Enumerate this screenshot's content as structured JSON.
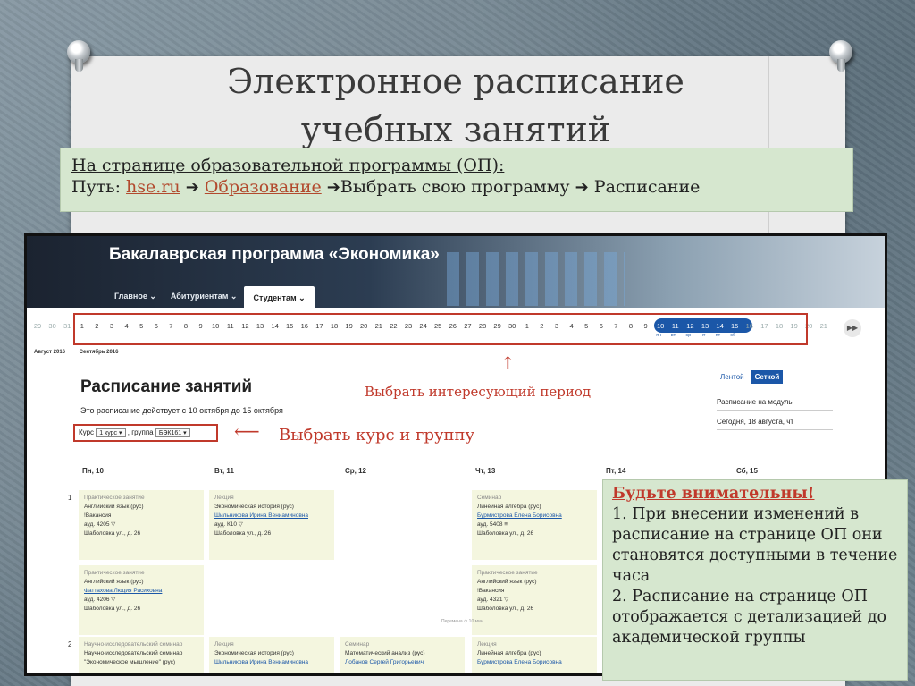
{
  "title": {
    "line1": "Электронное расписание",
    "line2": "учебных занятий"
  },
  "info": {
    "line1": "На странице образовательной программы (ОП):",
    "prefix": "Путь: ",
    "link1": "hse.ru",
    "link2": "Образование",
    "step3": "Выбрать свою программу",
    "step4": "Расписание",
    "arrow": "➔"
  },
  "site": {
    "banner_title": "Бакалаврская программа «Экономика»",
    "nav": [
      {
        "label": "Главное ⌄"
      },
      {
        "label": "Абитуриентам ⌄"
      },
      {
        "label": "Студентам ⌄"
      }
    ],
    "months": {
      "aug": "Август 2016",
      "sep": "Сентябрь 2016"
    },
    "days": [
      "29",
      "30",
      "31",
      "1",
      "2",
      "3",
      "4",
      "5",
      "6",
      "7",
      "8",
      "9",
      "10",
      "11",
      "12",
      "13",
      "14",
      "15",
      "16",
      "17",
      "18",
      "19",
      "20",
      "21",
      "22",
      "23",
      "24",
      "25",
      "26",
      "27",
      "28",
      "29",
      "30",
      "1",
      "2",
      "3",
      "4",
      "5",
      "6",
      "7",
      "8",
      "9",
      "10",
      "11",
      "12",
      "13",
      "14",
      "15",
      "16",
      "17",
      "18",
      "19",
      "20",
      "21"
    ],
    "selected_weekdays": [
      "пн",
      "вт",
      "ср",
      "чт",
      "пт",
      "сб"
    ],
    "page_title": "Расписание занятий",
    "subtitle": "Это расписание действует с 10 октября до 15 октября",
    "course_label": "Курс",
    "course_value": "1 курс ▾",
    "group_label": ", группа",
    "group_value": "БЭК161 ▾",
    "view_feed": "Лентой",
    "view_grid": "Сеткой",
    "module_link": "Расписание на модуль",
    "today": "Сегодня, 18 августа, чт",
    "columns": [
      "Пн, 10",
      "Вт, 11",
      "Ср, 12",
      "Чт, 13",
      "Пт, 14",
      "Сб, 15"
    ],
    "rows": [
      "1",
      "2"
    ],
    "cells": [
      {
        "type": "Практическое занятие",
        "subject": "Английский язык (рус)",
        "teacher": "!Вакансия",
        "room": "ауд. 4205 ▽",
        "address": "Шаболовка ул., д. 26"
      },
      {
        "type": "Лекция",
        "subject": "Экономическая история (рус)",
        "teacher": "Шильникова Ирина Вениаминовна",
        "room": "ауд. К10 ▽",
        "address": "Шаболовка ул., д. 26"
      },
      {
        "type": "Семинар",
        "subject": "Линейная алгебра (рус)",
        "teacher": "Бурмистрова Елена Борисовна",
        "room": "ауд. 5408 ≡",
        "address": "Шаболовка ул., д. 26"
      },
      {
        "type": "Практическое занятие",
        "subject": "Английский язык (рус)",
        "teacher": "Фаттахова Люция Расиховна",
        "room": "ауд. 4206 ▽",
        "address": "Шаболовка ул., д. 26"
      },
      {
        "type": "Практическое занятие",
        "subject": "Английский язык (рус)",
        "teacher": "!Вакансия",
        "room": "ауд. 4321 ▽",
        "address": "Шаболовка ул., д. 26"
      },
      {
        "type": "Научно-исследовательский семинар",
        "subject": "Научно-исследовательский семинар",
        "teacher": "\"Экономическое мышление\" (рус)",
        "room": "",
        "address": ""
      },
      {
        "type": "Лекция",
        "subject": "Экономическая история (рус)",
        "teacher": "Шильникова Ирина Вениаминовна",
        "room": "",
        "address": ""
      },
      {
        "type": "Семинар",
        "subject": "Математический анализ (рус)",
        "teacher": "Лобанов Сергей Григорьевич",
        "room": "",
        "address": ""
      },
      {
        "type": "Лекция",
        "subject": "Линейная алгебра (рус)",
        "teacher": "Бурмистрова Елена Борисовна",
        "room": "",
        "address": ""
      }
    ],
    "break_note": "Перемена ⊙ 10 мин"
  },
  "annotations": {
    "period": "Выбрать интересующий период",
    "course": "Выбрать курс и группу",
    "up_arrow": "↑",
    "left_arrow": "⟵"
  },
  "warning": {
    "title": "Будьте внимательны!",
    "p1": "1. При внесении изменений в расписание на странице ОП они становятся доступными в течение часа",
    "p2": "2. Расписание на странице ОП отображается с детализацией до академической группы"
  }
}
